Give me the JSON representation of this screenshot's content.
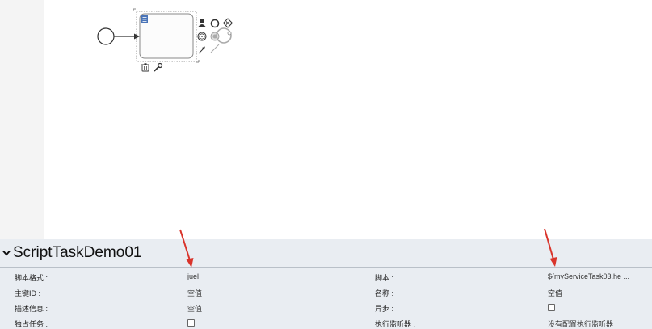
{
  "panel": {
    "title": "ScriptTaskDemo01",
    "rows": [
      {
        "label1": "脚本格式 :",
        "value1": "juel",
        "label2": "脚本 :",
        "value2": "${myServiceTask03.he ..."
      },
      {
        "label1": "主键ID :",
        "value1": "空值",
        "label2": "名称 :",
        "value2": "空值"
      },
      {
        "label1": "描述信息 :",
        "value1": "空值",
        "label2": "异步 :",
        "value2": ""
      },
      {
        "label1": "独占任务 :",
        "value1": "",
        "label2": "执行监听器 :",
        "value2": "没有配置执行监听器"
      }
    ]
  },
  "colors": {
    "panel_bg": "#e9edf2",
    "arrow": "#d9342b",
    "task_icon": "#4a74b8"
  }
}
